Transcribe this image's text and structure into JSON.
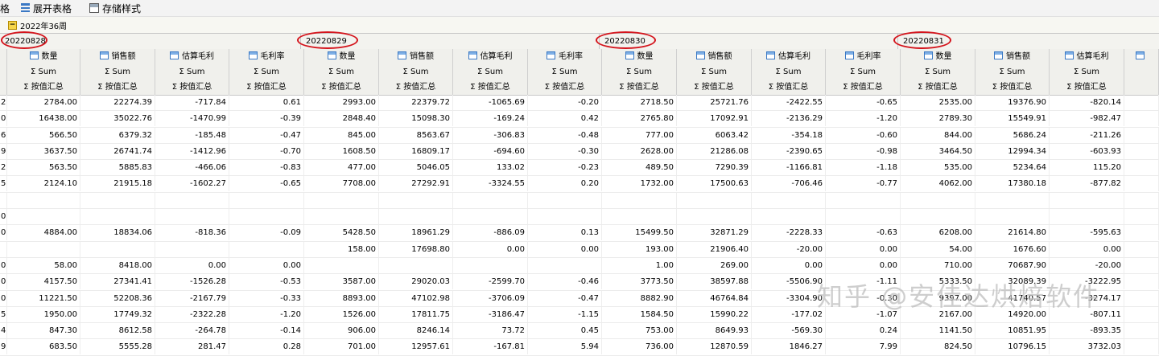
{
  "toolbar": {
    "left_fragment": "格",
    "expand_label": "展开表格",
    "save_label": "存储样式"
  },
  "week": {
    "toggle": "−",
    "label": "2022年36周"
  },
  "dates": [
    "20220828",
    "20220829",
    "20220830",
    "20220831"
  ],
  "metrics": [
    "数量",
    "销售额",
    "估算毛利",
    "毛利率"
  ],
  "sum_label": "Σ Sum",
  "agg_label": "Σ 按值汇总",
  "row_index": [
    "2",
    "0",
    "6",
    "9",
    "2",
    "5",
    "",
    "0",
    "0",
    "",
    "0",
    "0",
    "0",
    "5",
    "4",
    "9"
  ],
  "rows": [
    [
      "2784.00",
      "22274.39",
      "-717.84",
      "0.61",
      "2993.00",
      "22379.72",
      "-1065.69",
      "-0.20",
      "2718.50",
      "25721.76",
      "-2422.55",
      "-0.65",
      "2535.00",
      "19376.90",
      "-820.14"
    ],
    [
      "16438.00",
      "35022.76",
      "-1470.99",
      "-0.39",
      "2848.40",
      "15098.30",
      "-169.24",
      "0.42",
      "2765.80",
      "17092.91",
      "-2136.29",
      "-1.20",
      "2789.30",
      "15549.91",
      "-982.47"
    ],
    [
      "566.50",
      "6379.32",
      "-185.48",
      "-0.47",
      "845.00",
      "8563.67",
      "-306.83",
      "-0.48",
      "777.00",
      "6063.42",
      "-354.18",
      "-0.60",
      "844.00",
      "5686.24",
      "-211.26"
    ],
    [
      "3637.50",
      "26741.74",
      "-1412.96",
      "-0.70",
      "1608.50",
      "16809.17",
      "-694.60",
      "-0.30",
      "2628.00",
      "21286.08",
      "-2390.65",
      "-0.98",
      "3464.50",
      "12994.34",
      "-603.93"
    ],
    [
      "563.50",
      "5885.83",
      "-466.06",
      "-0.83",
      "477.00",
      "5046.05",
      "133.02",
      "-0.23",
      "489.50",
      "7290.39",
      "-1166.81",
      "-1.18",
      "535.00",
      "5234.64",
      "115.20"
    ],
    [
      "2124.10",
      "21915.18",
      "-1602.27",
      "-0.65",
      "7708.00",
      "27292.91",
      "-3324.55",
      "0.20",
      "1732.00",
      "17500.63",
      "-706.46",
      "-0.77",
      "4062.00",
      "17380.18",
      "-877.82"
    ],
    [
      "",
      "",
      "",
      "",
      "",
      "",
      "",
      "",
      "",
      "",
      "",
      "",
      "",
      "",
      ""
    ],
    [
      "",
      "",
      "",
      "",
      "",
      "",
      "",
      "",
      "",
      "",
      "",
      "",
      "",
      "",
      ""
    ],
    [
      "4884.00",
      "18834.06",
      "-818.36",
      "-0.09",
      "5428.50",
      "18961.29",
      "-886.09",
      "0.13",
      "15499.50",
      "32871.29",
      "-2228.33",
      "-0.63",
      "6208.00",
      "21614.80",
      "-595.63"
    ],
    [
      "",
      "",
      "",
      "",
      "158.00",
      "17698.80",
      "0.00",
      "0.00",
      "193.00",
      "21906.40",
      "-20.00",
      "0.00",
      "54.00",
      "1676.60",
      "0.00"
    ],
    [
      "58.00",
      "8418.00",
      "0.00",
      "0.00",
      "",
      "",
      "",
      "",
      "1.00",
      "269.00",
      "0.00",
      "0.00",
      "710.00",
      "70687.90",
      "-20.00"
    ],
    [
      "4157.50",
      "27341.41",
      "-1526.28",
      "-0.53",
      "3587.00",
      "29020.03",
      "-2599.70",
      "-0.46",
      "3773.50",
      "38597.88",
      "-5506.90",
      "-1.11",
      "5333.50",
      "32089.39",
      "-3222.95"
    ],
    [
      "11221.50",
      "52208.36",
      "-2167.79",
      "-0.33",
      "8893.00",
      "47102.98",
      "-3706.09",
      "-0.47",
      "8882.90",
      "46764.84",
      "-3304.90",
      "-0.30",
      "9397.00",
      "41740.57",
      "-3274.17"
    ],
    [
      "1950.00",
      "17749.32",
      "-2322.28",
      "-1.20",
      "1526.00",
      "17811.75",
      "-3186.47",
      "-1.15",
      "1584.50",
      "15990.22",
      "-177.02",
      "-1.07",
      "2167.00",
      "14920.00",
      "-807.11"
    ],
    [
      "847.30",
      "8612.58",
      "-264.78",
      "-0.14",
      "906.00",
      "8246.14",
      "73.72",
      "0.45",
      "753.00",
      "8649.93",
      "-569.30",
      "0.24",
      "1141.50",
      "10851.95",
      "-893.35"
    ],
    [
      "683.50",
      "5555.28",
      "281.47",
      "0.28",
      "701.00",
      "12957.61",
      "-167.81",
      "5.94",
      "736.00",
      "12870.59",
      "1846.27",
      "7.99",
      "824.50",
      "10796.15",
      "3732.03"
    ]
  ],
  "watermark": "知乎 @安佳达烘焙软件"
}
